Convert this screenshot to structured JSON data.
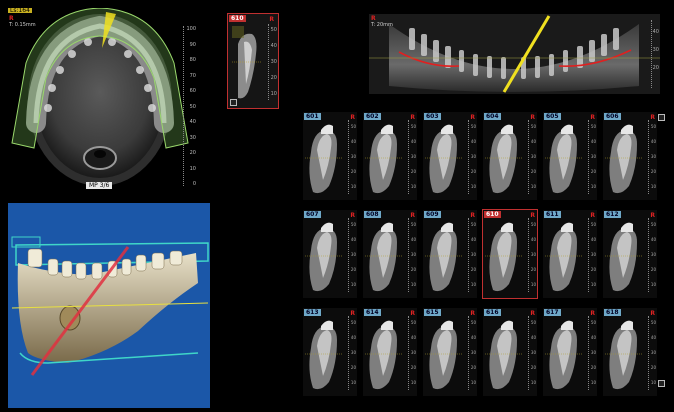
{
  "axial": {
    "slice_badge": "Ls:164",
    "marker": "R",
    "thickness": "T: 0.15mm",
    "mp_label": "MP 3/6",
    "ruler_ticks": [
      "100",
      "90",
      "80",
      "70",
      "60",
      "50",
      "40",
      "30",
      "20",
      "10",
      "0"
    ]
  },
  "sagittal_small": {
    "number": "610",
    "marker": "R",
    "ruler_ticks": [
      "50",
      "40",
      "30",
      "20",
      "10"
    ]
  },
  "panoramic": {
    "marker": "R",
    "distance": "T: 20mm",
    "ruler_ticks": [
      "40",
      "30",
      "20"
    ]
  },
  "cross_sections": {
    "active": "610",
    "marker": "R",
    "rows": [
      [
        "601",
        "602",
        "603",
        "604",
        "605",
        "606"
      ],
      [
        "607",
        "608",
        "609",
        "610",
        "611",
        "612"
      ],
      [
        "613",
        "614",
        "615",
        "616",
        "617",
        "618"
      ]
    ],
    "ruler_ticks": [
      "50",
      "40",
      "30",
      "20",
      "10"
    ]
  },
  "render3d": {
    "background": "#1b57a8"
  }
}
